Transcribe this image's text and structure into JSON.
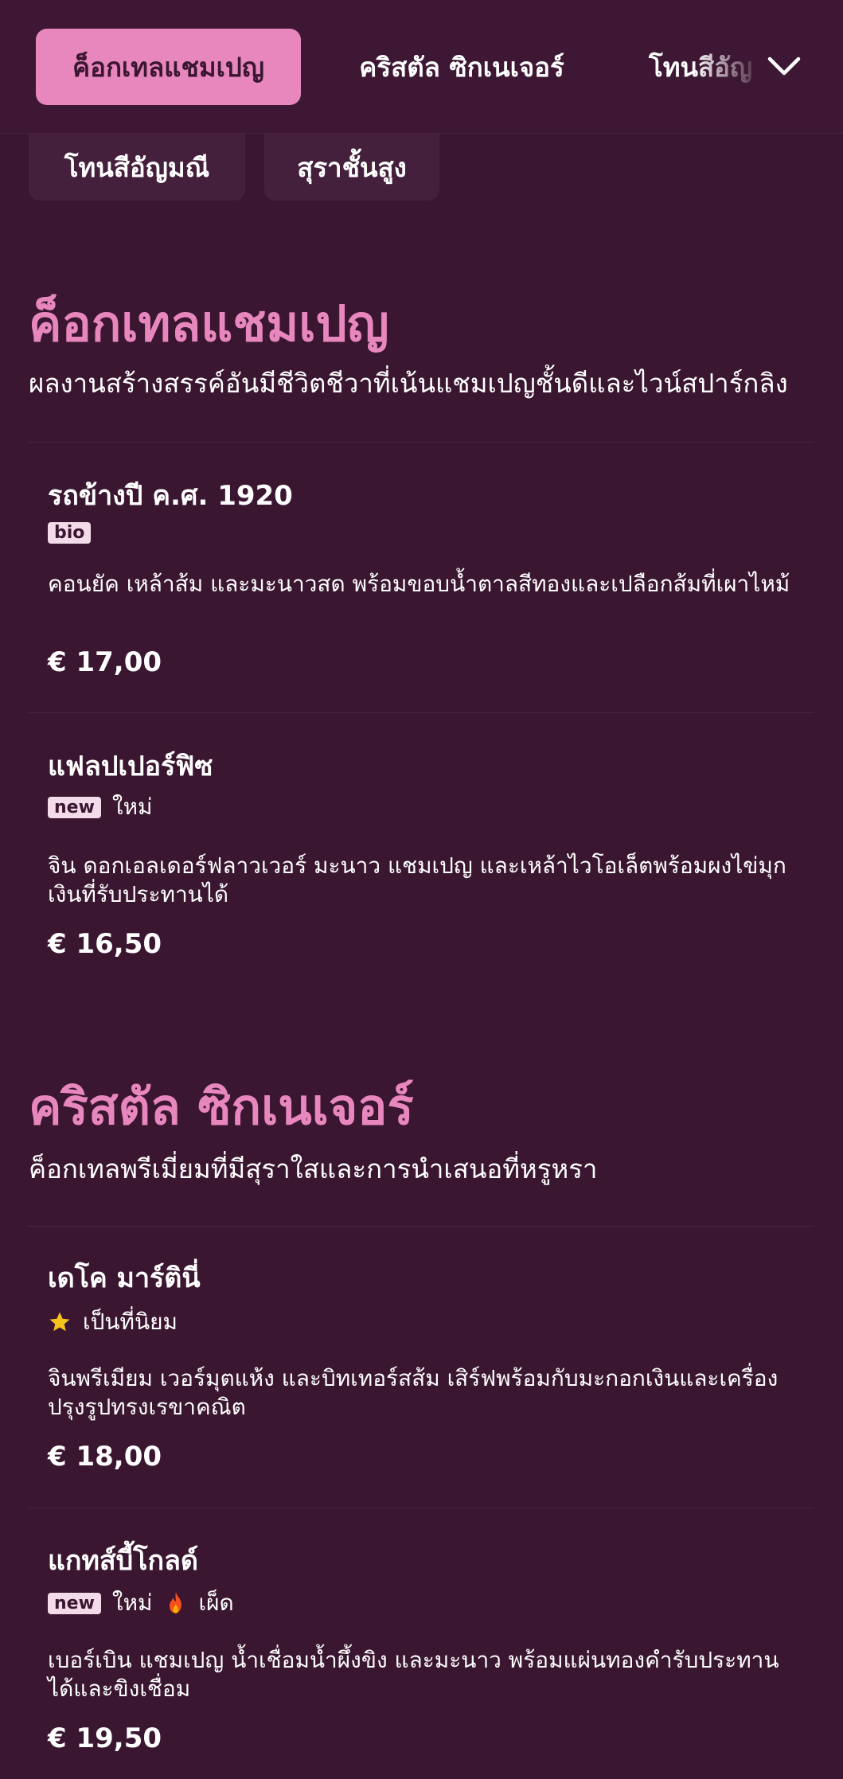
{
  "tabs": [
    {
      "label": "ค็อกเทลแชมเปญ",
      "active": true
    },
    {
      "label": "คริสตัล ซิกเนเจอร์",
      "active": false
    },
    {
      "label": "โทนสีอัญ",
      "active": false
    }
  ],
  "chips": [
    {
      "label": "โทนสีอัญมณี"
    },
    {
      "label": "สุราชั้นสูง"
    }
  ],
  "sections": [
    {
      "title": "ค็อกเทลแชมเปญ",
      "description": "ผลงานสร้างสรรค์อันมีชีวิตชีวาที่เน้นแชมเปญชั้นดีและไวน์สปาร์กลิง",
      "items": [
        {
          "name": "รถข้างปี ค.ศ. 1920",
          "badge": "bio",
          "description": "คอนยัค เหล้าส้ม และมะนาวสด พร้อมขอบน้ำตาลสีทองและเปลือกส้มที่เผาไหม้",
          "price": "€ 17,00"
        },
        {
          "name": "แฟลปเปอร์ฟิซ",
          "badge": "new",
          "tag_text": "ใหม่",
          "description": "จิน ดอกเอลเดอร์ฟลาวเวอร์ มะนาว แชมเปญ และเหล้าไวโอเล็ตพร้อมผงไข่มุกเงินที่รับประทานได้",
          "price": "€ 16,50"
        }
      ]
    },
    {
      "title": "คริสตัล ซิกเนเจอร์",
      "description": "ค็อกเทลพรีเมี่ยมที่มีสุราใสและการนำเสนอที่หรูหรา",
      "items": [
        {
          "name": "เดโค มาร์ตินี่",
          "tag_text": "เป็นที่นิยม",
          "description": "จินพรีเมียม เวอร์มุตแห้ง และบิทเทอร์สส้ม เสิร์ฟพร้อมกับมะกอกเงินและเครื่องปรุงรูปทรงเรขาคณิต",
          "price": "€ 18,00"
        },
        {
          "name": "แกทส์บี้โกลด์",
          "badge": "new",
          "tag_text": "ใหม่",
          "tag_text_2": "เผ็ด",
          "description": "เบอร์เบิน แชมเปญ น้ำเชื่อมน้ำผึ้งขิง และมะนาว พร้อมแผ่นทองคำรับประทานได้และขิงเชื่อม",
          "price": "€ 19,50"
        }
      ]
    }
  ],
  "colors": {
    "background": "#3a1630",
    "accent": "#e887bd",
    "badge_bg": "#f3dbe9",
    "star": "#f6c21c",
    "fire": "#f4511e"
  },
  "icons": {
    "menu_toggle": "chevron-down-icon",
    "popular": "star-icon",
    "spicy": "fire-icon"
  }
}
